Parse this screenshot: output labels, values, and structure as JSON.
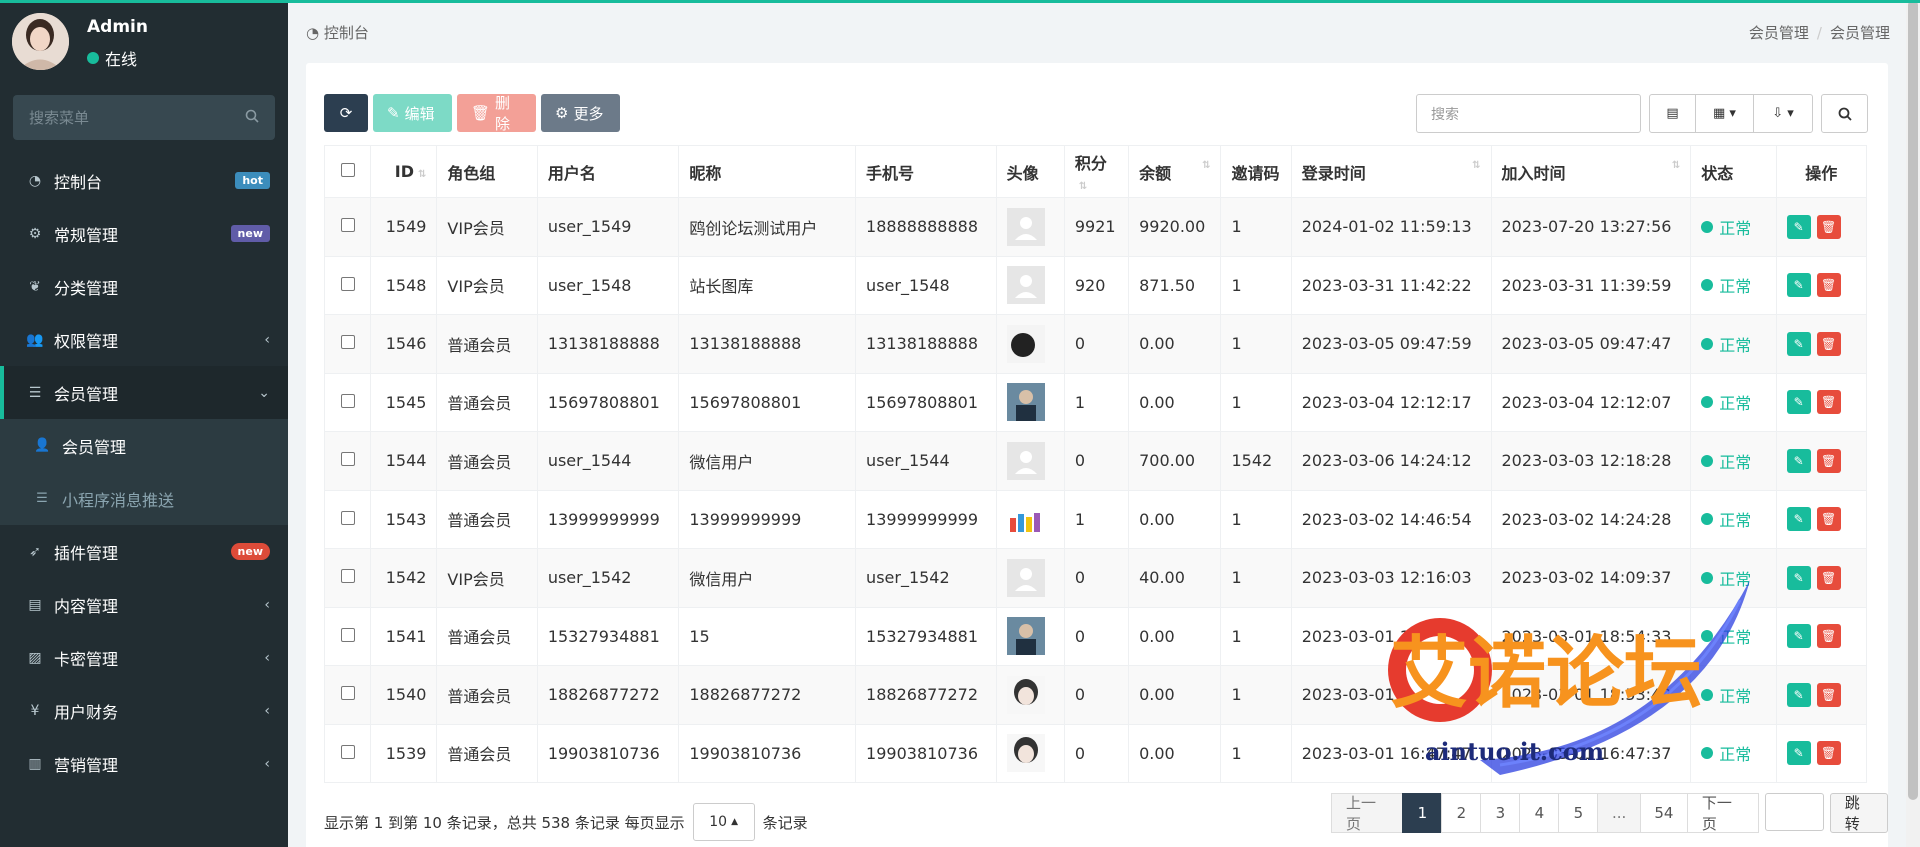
{
  "user": {
    "name": "Admin",
    "status": "在线"
  },
  "sidebar": {
    "search_placeholder": "搜索菜单",
    "items": [
      {
        "label": "控制台",
        "icon": "dashboard-icon",
        "badge": "hot"
      },
      {
        "label": "常规管理",
        "icon": "cogs-icon",
        "badge": "new"
      },
      {
        "label": "分类管理",
        "icon": "leaf-icon"
      },
      {
        "label": "权限管理",
        "icon": "group-icon",
        "caret": "‹"
      },
      {
        "label": "会员管理",
        "icon": "list-icon",
        "caret": "⌄"
      },
      {
        "label": "插件管理",
        "icon": "rocket-icon",
        "badge": "new"
      },
      {
        "label": "内容管理",
        "icon": "file-icon",
        "caret": "‹"
      },
      {
        "label": "卡密管理",
        "icon": "image-icon",
        "caret": "‹"
      },
      {
        "label": "用户财务",
        "icon": "yen-icon",
        "caret": "‹"
      },
      {
        "label": "营销管理",
        "icon": "bar-chart-icon",
        "caret": "‹"
      }
    ],
    "sub_items": [
      {
        "label": "会员管理",
        "icon": "user-icon"
      },
      {
        "label": "小程序消息推送",
        "icon": "list-icon"
      }
    ]
  },
  "breadcrumb": {
    "left": "控制台",
    "right": [
      "会员管理",
      "会员管理"
    ]
  },
  "toolbar": {
    "edit_label": "编辑",
    "delete_label": "删除",
    "more_label": "更多",
    "search_placeholder": "搜索"
  },
  "table": {
    "headers": [
      "ID",
      "角色组",
      "用户名",
      "昵称",
      "手机号",
      "头像",
      "积分",
      "余额",
      "邀请码",
      "登录时间",
      "加入时间",
      "状态",
      "操作"
    ],
    "rows": [
      {
        "id": "1549",
        "group": "VIP会员",
        "username": "user_1549",
        "nickname": "鸥创论坛测试用户",
        "mobile": "18888888888",
        "score": "9921",
        "money": "9920.00",
        "code": "1",
        "login": "2024-01-02 11:59:13",
        "join": "2023-07-20 13:27:56",
        "status": "正常"
      },
      {
        "id": "1548",
        "group": "VIP会员",
        "username": "user_1548",
        "nickname": "站长图库",
        "mobile": "user_1548",
        "score": "920",
        "money": "871.50",
        "code": "1",
        "login": "2023-03-31 11:42:22",
        "join": "2023-03-31 11:39:59",
        "status": "正常"
      },
      {
        "id": "1546",
        "group": "普通会员",
        "username": "13138188888",
        "nickname": "13138188888",
        "mobile": "13138188888",
        "score": "0",
        "money": "0.00",
        "code": "1",
        "login": "2023-03-05 09:47:59",
        "join": "2023-03-05 09:47:47",
        "status": "正常"
      },
      {
        "id": "1545",
        "group": "普通会员",
        "username": "15697808801",
        "nickname": "15697808801",
        "mobile": "15697808801",
        "score": "1",
        "money": "0.00",
        "code": "1",
        "login": "2023-03-04 12:12:17",
        "join": "2023-03-04 12:12:07",
        "status": "正常"
      },
      {
        "id": "1544",
        "group": "普通会员",
        "username": "user_1544",
        "nickname": "微信用户",
        "mobile": "user_1544",
        "score": "0",
        "money": "700.00",
        "code": "1542",
        "login": "2023-03-06 14:24:12",
        "join": "2023-03-03 12:18:28",
        "status": "正常"
      },
      {
        "id": "1543",
        "group": "普通会员",
        "username": "13999999999",
        "nickname": "13999999999",
        "mobile": "13999999999",
        "score": "1",
        "money": "0.00",
        "code": "1",
        "login": "2023-03-02 14:46:54",
        "join": "2023-03-02 14:24:28",
        "status": "正常"
      },
      {
        "id": "1542",
        "group": "VIP会员",
        "username": "user_1542",
        "nickname": "微信用户",
        "mobile": "user_1542",
        "score": "0",
        "money": "40.00",
        "code": "1",
        "login": "2023-03-03 12:16:03",
        "join": "2023-03-02 14:09:37",
        "status": "正常"
      },
      {
        "id": "1541",
        "group": "普通会员",
        "username": "15327934881",
        "nickname": "15",
        "mobile": "15327934881",
        "score": "0",
        "money": "0.00",
        "code": "1",
        "login": "2023-03-01 18:54:38",
        "join": "2023-03-01 18:54:33",
        "status": "正常"
      },
      {
        "id": "1540",
        "group": "普通会员",
        "username": "18826877272",
        "nickname": "18826877272",
        "mobile": "18826877272",
        "score": "0",
        "money": "0.00",
        "code": "1",
        "login": "2023-03-01 18:53:52",
        "join": "2023-03-01 18:53:42",
        "status": "正常"
      },
      {
        "id": "1539",
        "group": "普通会员",
        "username": "19903810736",
        "nickname": "19903810736",
        "mobile": "19903810736",
        "score": "0",
        "money": "0.00",
        "code": "1",
        "login": "2023-03-01 16:47:47",
        "join": "2023-03-01 16:47:37",
        "status": "正常"
      }
    ]
  },
  "footer": {
    "summary": "显示第 1 到第 10 条记录，总共 538 条记录 每页显示",
    "page_size": "10",
    "suffix": "条记录",
    "pages": [
      "上一页",
      "1",
      "2",
      "3",
      "4",
      "5",
      "...",
      "54",
      "下一页"
    ],
    "jump_label": "跳转"
  },
  "watermark": {
    "text": "艾诺论坛",
    "url": "aintuo.it.com"
  }
}
